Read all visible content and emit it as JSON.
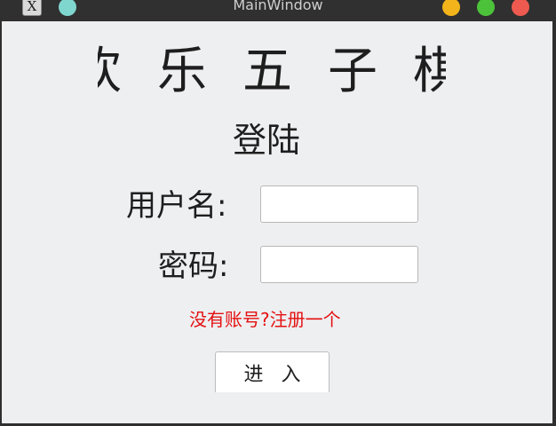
{
  "window": {
    "title": "MainWindow",
    "app_icon_glyph": "X",
    "controls": {
      "minimize_color": "#f2b41a",
      "maximize_color": "#4cc23a",
      "close_color": "#ee5a4f",
      "pin_color": "#7fd6cf"
    }
  },
  "main": {
    "game_title": "欢乐五子棋",
    "login_heading": "登陆",
    "username_label": "用户名:",
    "password_label": "密码:",
    "username_value": "",
    "password_value": "",
    "register_link": "没有账号?注册一个",
    "enter_button": "进入"
  },
  "colors": {
    "background": "#eeeff1",
    "register_link": "#e41010",
    "text": "#1e1e1e"
  }
}
